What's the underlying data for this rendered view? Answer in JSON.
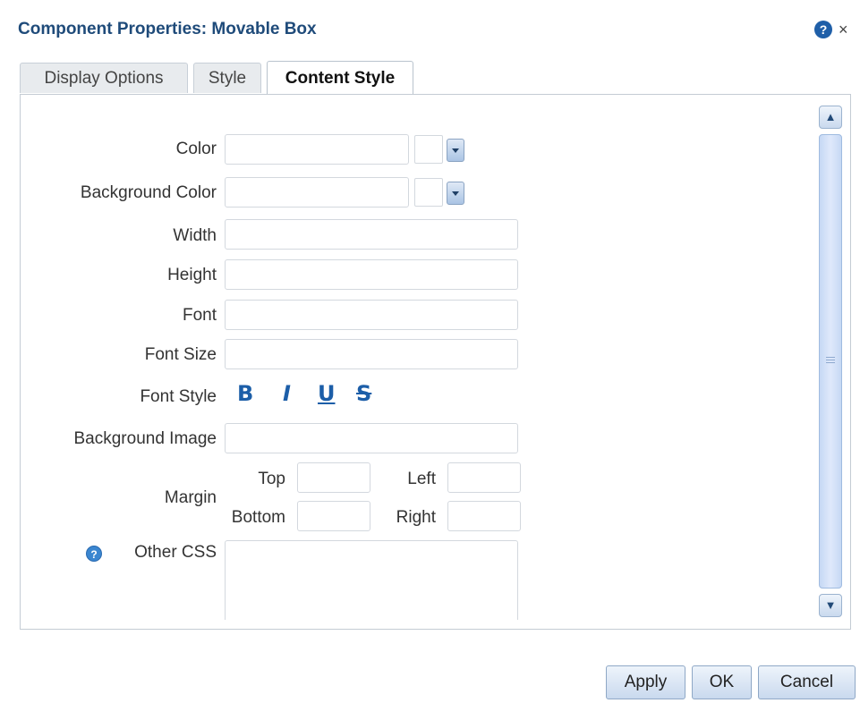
{
  "dialog": {
    "title": "Component Properties: Movable Box",
    "help_glyph": "?",
    "close_glyph": "×"
  },
  "tabs": [
    {
      "label": "Display Options",
      "active": false
    },
    {
      "label": "Style",
      "active": false
    },
    {
      "label": "Content Style",
      "active": true
    }
  ],
  "form": {
    "color_label": "Color",
    "bg_color_label": "Background Color",
    "width_label": "Width",
    "height_label": "Height",
    "font_label": "Font",
    "font_size_label": "Font Size",
    "font_style_label": "Font Style",
    "font_style_buttons": {
      "bold": "B",
      "italic": "I",
      "underline": "U",
      "strike": "S"
    },
    "bg_image_label": "Background Image",
    "margin_label": "Margin",
    "margin_top_label": "Top",
    "margin_left_label": "Left",
    "margin_bottom_label": "Bottom",
    "margin_right_label": "Right",
    "other_css_label": "Other CSS",
    "other_css_help_glyph": "?",
    "values": {
      "color": "",
      "bg_color": "",
      "width": "",
      "height": "",
      "font": "",
      "font_size": "",
      "bg_image": "",
      "margin_top": "",
      "margin_left": "",
      "margin_bottom": "",
      "margin_right": "",
      "other_css": ""
    }
  },
  "scrollbar": {
    "up_glyph": "▲",
    "down_glyph": "▼"
  },
  "buttons": {
    "apply": "Apply",
    "ok": "OK",
    "cancel": "Cancel"
  },
  "colors": {
    "title": "#1f4b7a",
    "accent": "#1c5ea8"
  }
}
